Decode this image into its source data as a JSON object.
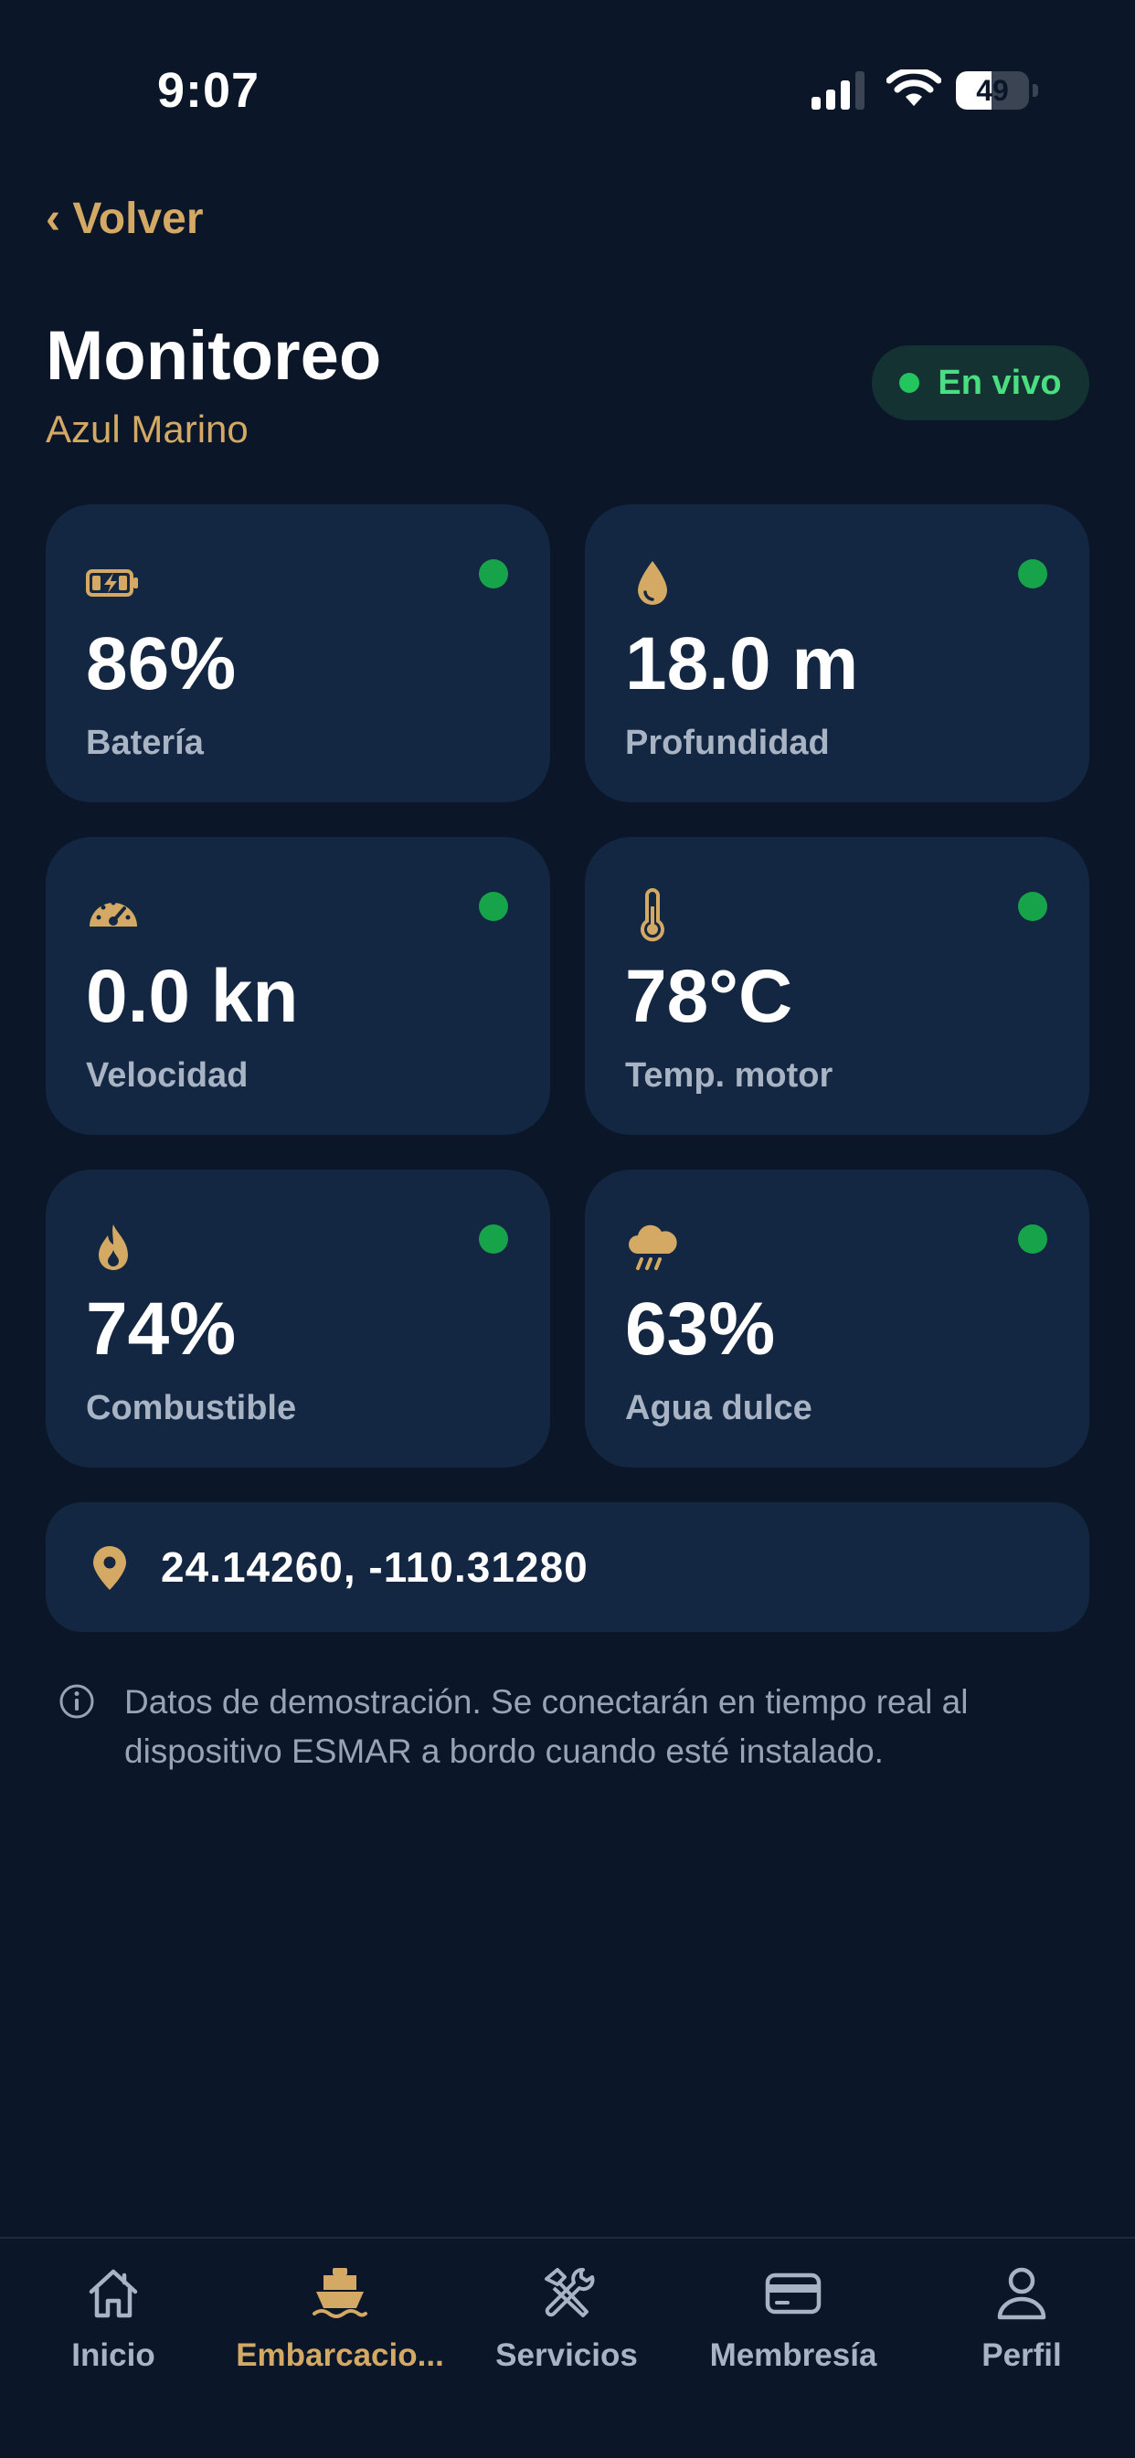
{
  "status_bar": {
    "time": "9:07",
    "battery": "49",
    "battery_level": 0.49
  },
  "header": {
    "back_label": "‹ Volver",
    "title": "Monitoreo",
    "subtitle": "Azul Marino",
    "live_label": "En vivo"
  },
  "metrics": [
    {
      "value": "86%",
      "label": "Batería",
      "icon": "battery-charging-icon",
      "status": "ok"
    },
    {
      "value": "18.0 m",
      "label": "Profundidad",
      "icon": "water-drop-icon",
      "status": "ok"
    },
    {
      "value": "0.0 kn",
      "label": "Velocidad",
      "icon": "speedometer-icon",
      "status": "ok"
    },
    {
      "value": "78°C",
      "label": "Temp. motor",
      "icon": "thermometer-icon",
      "status": "ok"
    },
    {
      "value": "74%",
      "label": "Combustible",
      "icon": "flame-icon",
      "status": "ok"
    },
    {
      "value": "63%",
      "label": "Agua dulce",
      "icon": "rain-cloud-icon",
      "status": "ok"
    }
  ],
  "location": {
    "coordinates": "24.14260, -110.31280",
    "icon": "map-pin-icon"
  },
  "note": {
    "text": "Datos de demostración. Se conectarán en tiempo real al dispositivo ESMAR a bordo cuando esté instalado.",
    "icon": "info-icon"
  },
  "nav": {
    "items": [
      {
        "label": "Inicio",
        "icon": "home-icon",
        "active": false
      },
      {
        "label": "Embarcacio...",
        "icon": "boat-icon",
        "active": true
      },
      {
        "label": "Servicios",
        "icon": "tools-icon",
        "active": false
      },
      {
        "label": "Membresía",
        "icon": "credit-card-icon",
        "active": false
      },
      {
        "label": "Perfil",
        "icon": "user-icon",
        "active": false
      }
    ]
  },
  "colors": {
    "background": "#0b1729",
    "card": "#132642",
    "accent_gold": "#d3a964",
    "status_green": "#16a34a",
    "muted_text": "#a8b3c4"
  }
}
